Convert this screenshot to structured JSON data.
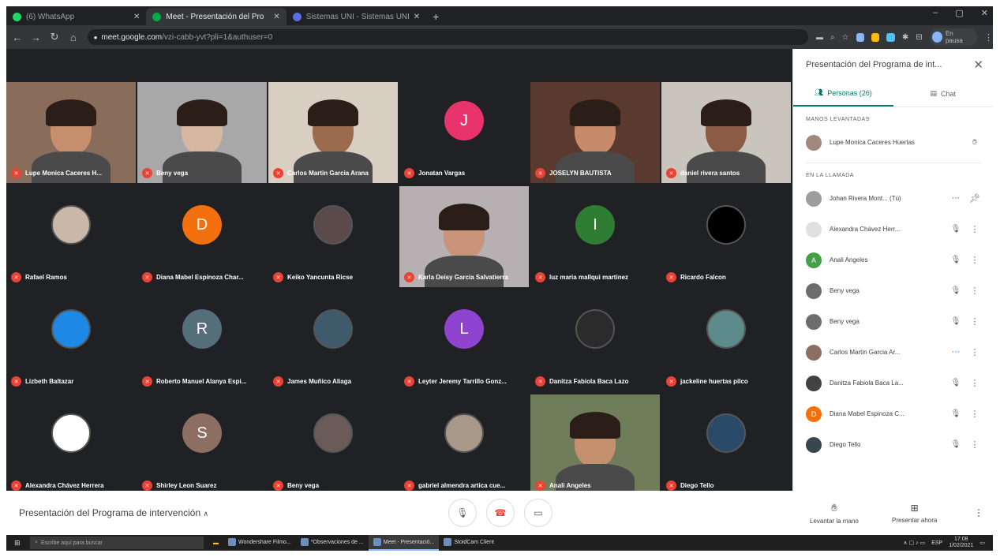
{
  "tabs": [
    {
      "label": "(6) WhatsApp",
      "color": "#25d366",
      "active": false
    },
    {
      "label": "Meet - Presentación del Pro",
      "color": "#00ac47",
      "active": true
    },
    {
      "label": "Sistemas UNI - Sistemas UNI",
      "color": "#5b6ee1",
      "active": false
    }
  ],
  "address": {
    "host": "meet.google.com",
    "path": "/vzi-cabb-yvt?pli=1&authuser=0"
  },
  "profile": {
    "label": "En pausa"
  },
  "tiles": [
    {
      "name": "Lupe Monica Caceres H...",
      "kind": "photo",
      "bg": "#8a6c5a",
      "face": "#c58e6c"
    },
    {
      "name": "Beny vega",
      "kind": "photo",
      "bg": "#a8a8a8",
      "face": "#d6b7a2"
    },
    {
      "name": "Carlos Martin Garcia Arana",
      "kind": "photo",
      "bg": "#d8cfc2",
      "face": "#9c6a4f"
    },
    {
      "name": "Jonatan Vargas",
      "kind": "letter",
      "letter": "J",
      "color": "#e8336d"
    },
    {
      "name": "JOSELYN BAUTISTA",
      "kind": "photo",
      "bg": "#5a3a2e",
      "face": "#c88a6a"
    },
    {
      "name": "daniel rivera santos",
      "kind": "photo",
      "bg": "#c9c5bd",
      "face": "#8c5b44"
    },
    {
      "name": "Rafael Ramos",
      "kind": "circle",
      "color": "#c9b8a8"
    },
    {
      "name": "Diana Mabel Espinoza Char...",
      "kind": "letter",
      "letter": "D",
      "color": "#f4700e"
    },
    {
      "name": "Keiko Yancunta Ricse",
      "kind": "circle",
      "color": "#5b4a4a"
    },
    {
      "name": "Karla Deisy Garcia Salvatierra",
      "kind": "photo",
      "bg": "#b7b0b2",
      "face": "#c9937a"
    },
    {
      "name": "luz maria mallqui martinez",
      "kind": "letter",
      "letter": "I",
      "color": "#2e7d32"
    },
    {
      "name": "Ricardo Falcon",
      "kind": "circle",
      "color": "#000000"
    },
    {
      "name": "Lizbeth Baltazar",
      "kind": "circle",
      "color": "#1e88e5"
    },
    {
      "name": "Roberto Manuel Alanya Espi...",
      "kind": "letter",
      "letter": "R",
      "color": "#546e7a"
    },
    {
      "name": "James Muñico Aliaga",
      "kind": "circle",
      "color": "#3f5a6b"
    },
    {
      "name": "Leyter Jeremy Tarrillo Gonz...",
      "kind": "letter",
      "letter": "L",
      "color": "#8e44ce"
    },
    {
      "name": "Danitza Fabiola Baca Lazo",
      "kind": "circle",
      "color": "#2b2b2b"
    },
    {
      "name": "jackeline huertas pilco",
      "kind": "circle",
      "color": "#5d8a8a"
    },
    {
      "name": "Alexandra Chávez Herrera",
      "kind": "circle",
      "color": "#ffffff"
    },
    {
      "name": "Shirley Leon Suarez",
      "kind": "letter",
      "letter": "S",
      "color": "#8d6e63"
    },
    {
      "name": "Beny vega",
      "kind": "circle",
      "color": "#6a5a58"
    },
    {
      "name": "gabriel almendra artica cue...",
      "kind": "circle",
      "color": "#a89888"
    },
    {
      "name": "Anali Angeles",
      "kind": "photo",
      "bg": "#6f7d5a",
      "face": "#c4906e"
    },
    {
      "name": "Diego Tello",
      "kind": "circle",
      "color": "#2a4a6a"
    }
  ],
  "panel": {
    "title": "Presentación del Programa de int...",
    "tab_people": "Personas (26)",
    "tab_chat": "Chat",
    "raised_header": "MANOS LEVANTADAS",
    "raised": [
      {
        "name": "Lupe Monica Caceres Huertas",
        "color": "#a1887f"
      }
    ],
    "call_header": "EN LA LLAMADA",
    "people": [
      {
        "name": "Johan Rivera Mont...",
        "suffix": "(Tú)",
        "color": "#9e9e9e",
        "icon": "pin"
      },
      {
        "name": "Alexandra Chávez Herr...",
        "suffix": "",
        "color": "#e0e0e0",
        "icon": "mute"
      },
      {
        "name": "Anali Angeles",
        "suffix": "",
        "color": "#43a047",
        "icon": "mute",
        "letter": "A"
      },
      {
        "name": "Beny vega",
        "suffix": "",
        "color": "#6d6d6d",
        "icon": "mute"
      },
      {
        "name": "Beny vega",
        "suffix": "",
        "color": "#6d6d6d",
        "icon": "mute"
      },
      {
        "name": "Carlos Martin Garcia Ar...",
        "suffix": "",
        "color": "#8d6e63",
        "icon": "speak"
      },
      {
        "name": "Danitza Fabiola Baca La...",
        "suffix": "",
        "color": "#424242",
        "icon": "mute"
      },
      {
        "name": "Diana Mabel Espinoza C...",
        "suffix": "",
        "color": "#f4700e",
        "icon": "mute",
        "letter": "D"
      },
      {
        "name": "Diego Tello",
        "suffix": "",
        "color": "#37474f",
        "icon": "mute"
      }
    ]
  },
  "bottom": {
    "meeting_title": "Presentación del Programa de intervención",
    "raise_hand": "Levantar la mano",
    "present": "Presentar ahora"
  },
  "taskbar": {
    "search": "Escribe aquí para buscar",
    "apps": [
      "Wondershare Filmo...",
      "*Observaciones de ...",
      "Meet - Presentació...",
      "StoidCam Client"
    ],
    "lang": "ESP",
    "time": "17:08",
    "date": "1/02/2021"
  }
}
